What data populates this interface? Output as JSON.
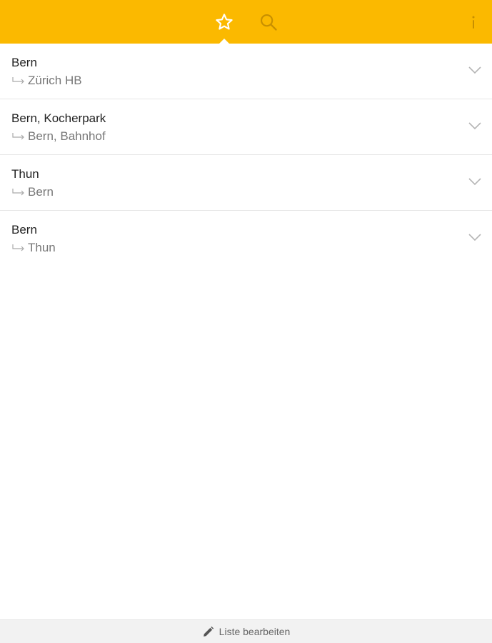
{
  "colors": {
    "accent": "#fbb900",
    "accent_dark": "#c78f00"
  },
  "header": {
    "tabs": [
      {
        "name": "favorites",
        "icon": "star-icon",
        "active": true
      },
      {
        "name": "search",
        "icon": "search-icon",
        "active": false
      }
    ],
    "info_label": "i"
  },
  "favorites": [
    {
      "from": "Bern",
      "to": "Zürich HB"
    },
    {
      "from": "Bern, Kocherpark",
      "to": "Bern, Bahnhof"
    },
    {
      "from": "Thun",
      "to": "Bern"
    },
    {
      "from": "Bern",
      "to": "Thun"
    }
  ],
  "footer": {
    "icon": "pencil-icon",
    "edit_label": "Liste bearbeiten"
  }
}
